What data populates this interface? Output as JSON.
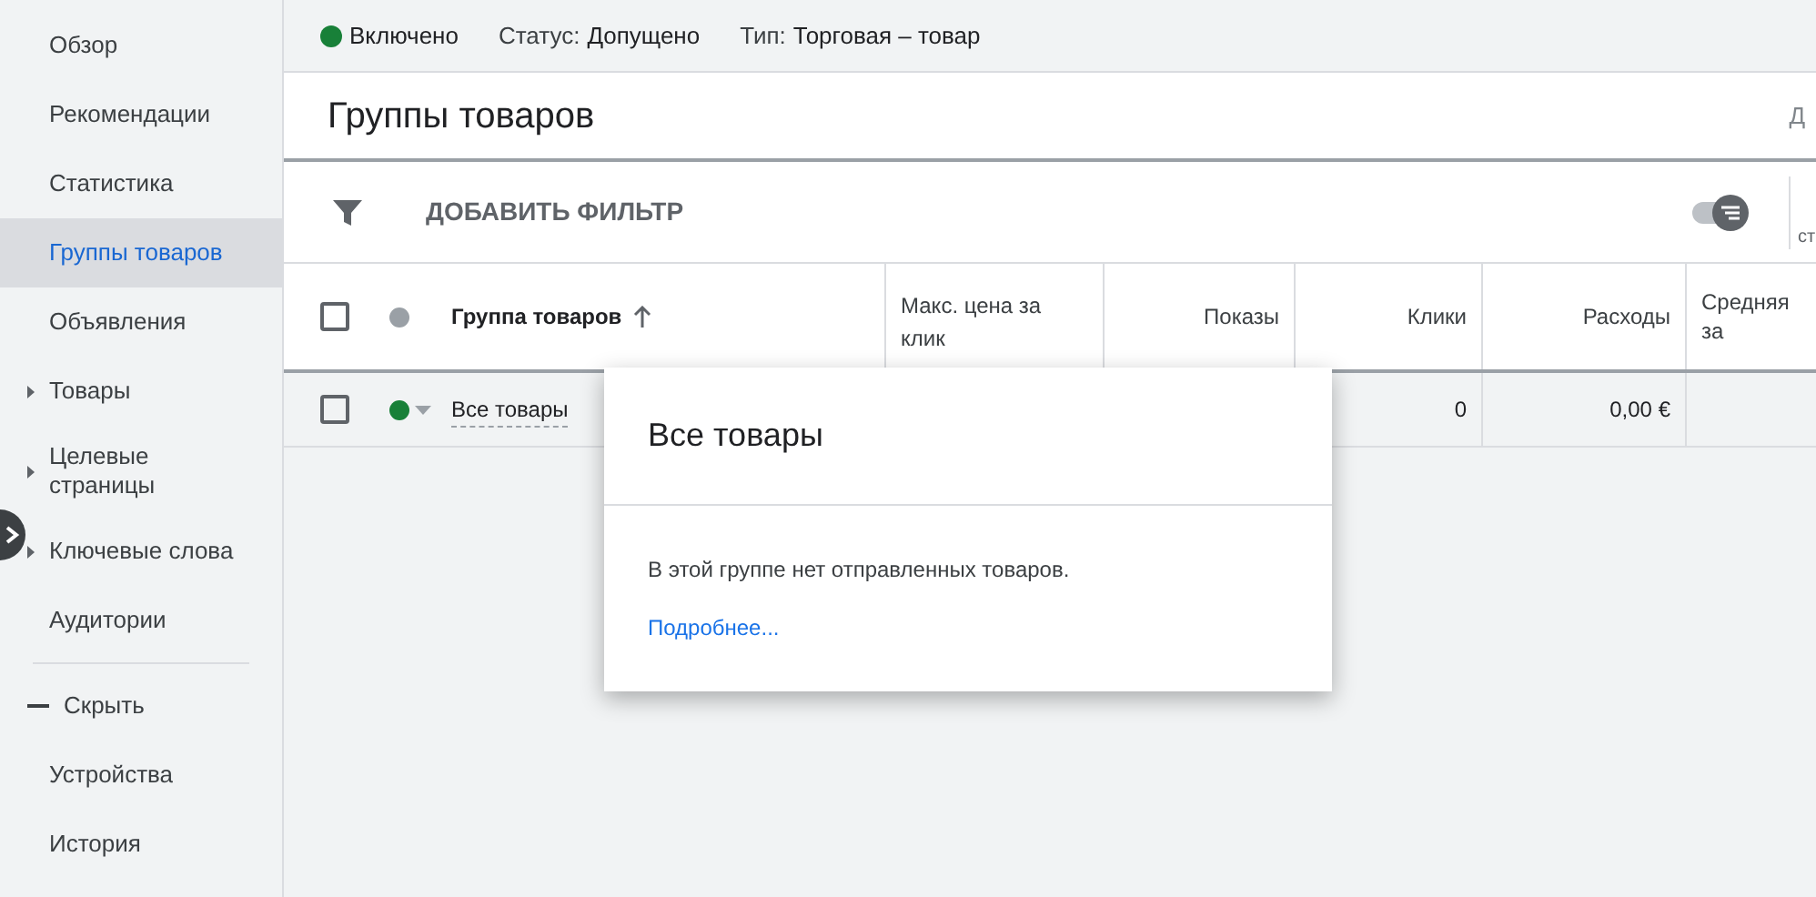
{
  "sidebar": {
    "items": [
      {
        "label": "Обзор",
        "selected": false,
        "kind": "link"
      },
      {
        "label": "Рекомендации",
        "selected": false,
        "kind": "link"
      },
      {
        "label": "Статистика",
        "selected": false,
        "kind": "link"
      },
      {
        "label": "Группы товаров",
        "selected": true,
        "kind": "link"
      },
      {
        "label": "Объявления",
        "selected": false,
        "kind": "link"
      },
      {
        "label": "Товары",
        "selected": false,
        "kind": "expandable"
      },
      {
        "label": "Целевые страницы",
        "selected": false,
        "kind": "expandable"
      },
      {
        "label": "Ключевые слова",
        "selected": false,
        "kind": "expandable"
      },
      {
        "label": "Аудитории",
        "selected": false,
        "kind": "link"
      },
      {
        "label": "Скрыть",
        "selected": false,
        "kind": "collapse"
      },
      {
        "label": "Устройства",
        "selected": false,
        "kind": "link"
      },
      {
        "label": "История",
        "selected": false,
        "kind": "link"
      }
    ]
  },
  "status_bar": {
    "state": "Включено",
    "status_label": "Статус:",
    "status_value": "Допущено",
    "type_label": "Тип:",
    "type_value": "Торговая – товар"
  },
  "page_title": "Группы товаров",
  "title_right": "Д",
  "toolbar": {
    "add_filter": "ДОБАВИТЬ ФИЛЬТР",
    "filter_toggle_on": true,
    "select_all_checked": false,
    "right_label": "ст"
  },
  "table": {
    "columns": [
      "Группа товаров",
      "Макс. цена за клик",
      "Показы",
      "Клики",
      "Расходы",
      "Средняя за"
    ],
    "rows": [
      {
        "name": "Все товары",
        "color": "#188038",
        "checked": false,
        "clicks": "0",
        "cost": "0,00 €"
      }
    ]
  },
  "popup": {
    "title": "Все товары",
    "message": "В этой группе нет отправленных товаров.",
    "link": "Подробнее..."
  }
}
